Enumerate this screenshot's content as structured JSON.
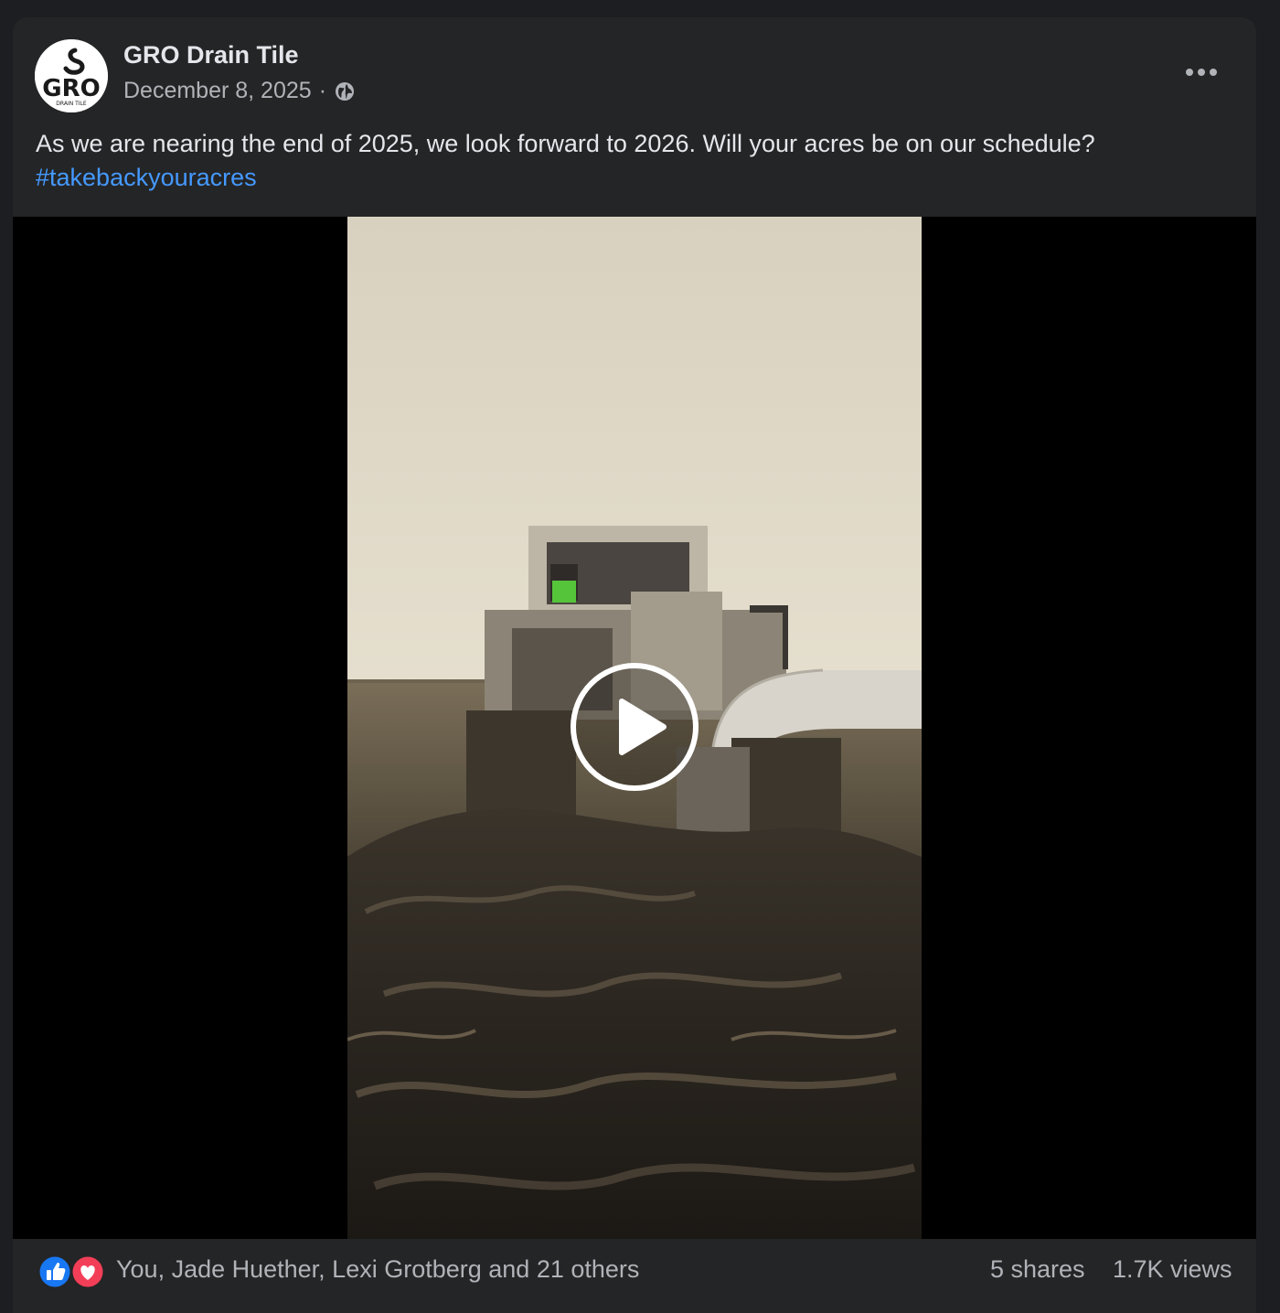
{
  "post": {
    "author": "GRO Drain Tile",
    "date": "December 8, 2025",
    "separator": "·",
    "audience_icon": "globe-icon",
    "text": "As we are nearing the end of 2025, we look forward to 2026. Will your acres be on our schedule?",
    "hashtag": "#takebackyouracres",
    "avatar_text": "GRO",
    "avatar_subtext": "DRAIN TILE"
  },
  "media": {
    "type": "video",
    "play_icon": "play-icon"
  },
  "reactions": {
    "icons": [
      "like-icon",
      "love-icon"
    ],
    "summary": "You, Jade Huether, Lexi Grotberg and 21 others",
    "shares": "5 shares",
    "views": "1.7K views"
  },
  "colors": {
    "background": "#1c1e21",
    "card": "#242526",
    "primary_text": "#e4e6eb",
    "secondary_text": "#b0b3b8",
    "hashtag": "#4599ff",
    "like": "#1877f2",
    "love": "#f33e58"
  }
}
